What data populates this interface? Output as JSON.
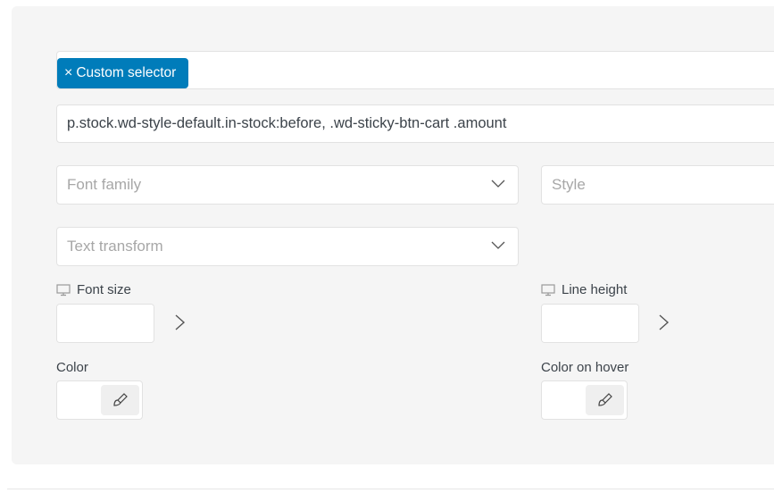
{
  "selector": {
    "tag_label": "Custom selector",
    "tag_remove_icon": "close-icon",
    "value": "p.stock.wd-style-default.in-stock:before, .wd-sticky-btn-cart .amount"
  },
  "fields": {
    "font_family": {
      "placeholder": "Font family",
      "icon": "chevron-down-icon"
    },
    "style": {
      "placeholder": "Style"
    },
    "text_transform": {
      "placeholder": "Text transform",
      "icon": "chevron-down-icon"
    },
    "font_size": {
      "label": "Font size",
      "device_icon": "desktop-icon",
      "value": "",
      "unit": "px"
    },
    "line_height": {
      "label": "Line height",
      "device_icon": "desktop-icon",
      "value": "",
      "unit": "px"
    },
    "color": {
      "label": "Color",
      "picker_icon": "brush-icon"
    },
    "color_hover": {
      "label": "Color on hover",
      "picker_icon": "brush-icon"
    }
  },
  "colors": {
    "accent": "#007cba",
    "panel_bg": "#f5f5f5"
  }
}
